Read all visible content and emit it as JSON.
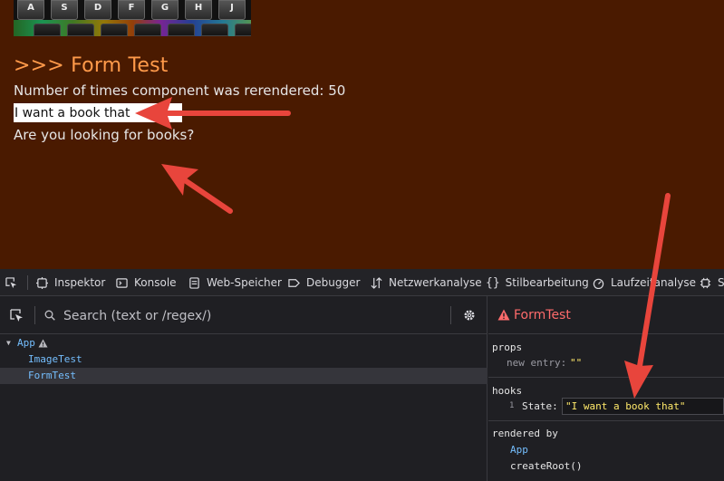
{
  "page": {
    "keyboard_keys": [
      "A",
      "S",
      "D",
      "F",
      "G",
      "H",
      "J"
    ],
    "form_title": ">>> Form Test",
    "rerender_text": "Number of times component was rerendered: 50",
    "input_value": "I want a book that",
    "question": "Are you looking for books?"
  },
  "devtools": {
    "tabs": [
      {
        "label": "Inspektor",
        "icon": "inspector-icon"
      },
      {
        "label": "Konsole",
        "icon": "console-icon"
      },
      {
        "label": "Web-Speicher",
        "icon": "storage-icon"
      },
      {
        "label": "Debugger",
        "icon": "debugger-icon"
      },
      {
        "label": "Netzwerkanalyse",
        "icon": "network-icon"
      },
      {
        "label": "Stilbearbeitung",
        "icon": "style-editor-icon"
      },
      {
        "label": "Laufzeitanalyse",
        "icon": "performance-icon"
      },
      {
        "label": "S",
        "icon": "components-icon"
      }
    ],
    "search_placeholder": "Search (text or /regex/)",
    "tree": [
      {
        "label": "App",
        "depth": 0,
        "expanded": true,
        "warning": true,
        "selected": false
      },
      {
        "label": "ImageTest",
        "depth": 1,
        "selected": false
      },
      {
        "label": "FormTest",
        "depth": 1,
        "selected": true
      }
    ],
    "inspector": {
      "component_name": "FormTest",
      "props_title": "props",
      "props": [
        {
          "key": "new entry",
          "value": "\"\""
        }
      ],
      "hooks_title": "hooks",
      "hooks": [
        {
          "index": "1",
          "key": "State:",
          "value": "\"I want a book that\""
        }
      ],
      "rendered_by_title": "rendered by",
      "rendered_by": [
        "App",
        "createRoot()"
      ]
    }
  },
  "colors": {
    "page_background": "#4a1a00",
    "title_orange": "#ff9a4a",
    "annotation_red": "#e8453c",
    "tree_blue": "#75bfff",
    "component_red": "#ff6b6b",
    "value_yellow": "#ffe96a"
  }
}
